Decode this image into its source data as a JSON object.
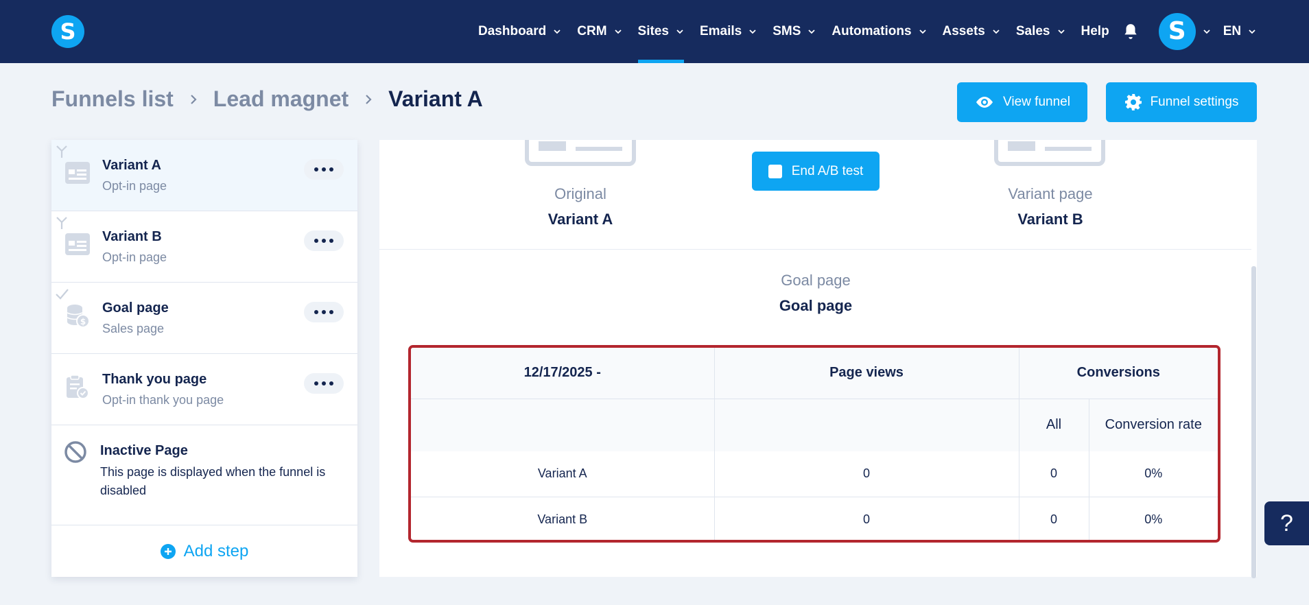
{
  "brand": {
    "logo_letter": "S",
    "accent": "#0ea5f2",
    "nav_bg": "#162b5e"
  },
  "nav": {
    "items": [
      {
        "label": "Dashboard",
        "dropdown": true
      },
      {
        "label": "CRM",
        "dropdown": true
      },
      {
        "label": "Sites",
        "dropdown": true,
        "active": true
      },
      {
        "label": "Emails",
        "dropdown": true
      },
      {
        "label": "SMS",
        "dropdown": true
      },
      {
        "label": "Automations",
        "dropdown": true
      },
      {
        "label": "Assets",
        "dropdown": true
      },
      {
        "label": "Sales",
        "dropdown": true
      }
    ],
    "help_label": "Help",
    "notifications_icon": "bell-icon",
    "avatar_letter": "S",
    "language": "EN"
  },
  "breadcrumb": {
    "items": [
      "Funnels list",
      "Lead magnet"
    ],
    "current": "Variant A"
  },
  "header_actions": {
    "view_funnel": "View funnel",
    "funnel_settings": "Funnel settings"
  },
  "sidebar": {
    "steps": [
      {
        "title": "Variant A",
        "subtitle": "Opt-in page",
        "icon": "page-layout-icon",
        "marker": "split-icon",
        "active": true
      },
      {
        "title": "Variant B",
        "subtitle": "Opt-in page",
        "icon": "page-layout-icon",
        "marker": "split-icon"
      },
      {
        "title": "Goal page",
        "subtitle": "Sales page",
        "icon": "coins-icon",
        "marker": "check-icon"
      },
      {
        "title": "Thank you page",
        "subtitle": "Opt-in thank you page",
        "icon": "clipboard-check-icon"
      }
    ],
    "inactive": {
      "title": "Inactive Page",
      "description": "This page is displayed when the funnel is disabled"
    },
    "add_step": "Add step"
  },
  "ab_test": {
    "original_label": "Original",
    "original_name": "Variant A",
    "variant_label": "Variant page",
    "variant_name": "Variant B",
    "end_button": "End A/B test",
    "goal_label": "Goal page",
    "goal_name": "Goal page"
  },
  "stats": {
    "header": {
      "date": "12/17/2025 -",
      "page_views": "Page views",
      "conversions": "Conversions"
    },
    "subheader": {
      "all": "All",
      "conversion_rate": "Conversion rate"
    },
    "rows": [
      {
        "name": "Variant A",
        "page_views": "0",
        "all": "0",
        "rate": "0%"
      },
      {
        "name": "Variant B",
        "page_views": "0",
        "all": "0",
        "rate": "0%"
      }
    ]
  },
  "help_button": "?"
}
